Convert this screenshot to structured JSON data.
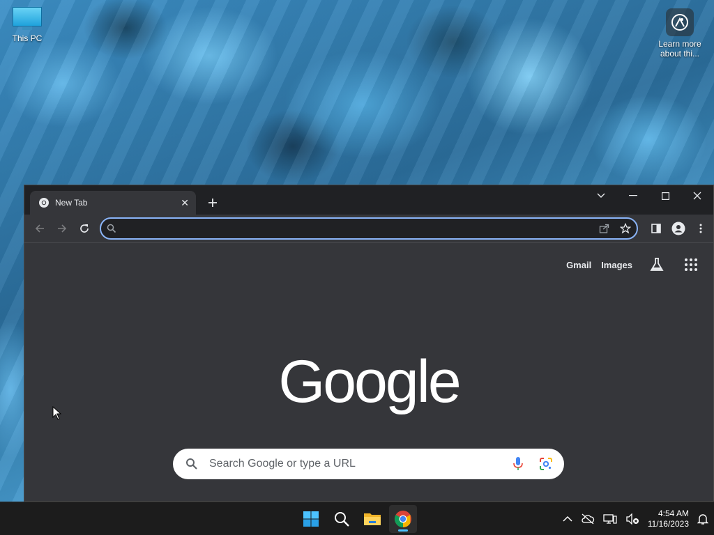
{
  "desktop": {
    "icons": [
      {
        "label": "This PC",
        "icon": "computer-icon"
      },
      {
        "label": "Learn more about thi...",
        "icon": "camera-lens-icon"
      }
    ]
  },
  "browser": {
    "tab": {
      "title": "New Tab",
      "icon": "chrome-icon",
      "close_icon": "close-icon"
    },
    "new_tab_icon": "plus-icon",
    "window_controls": [
      "chevron-down-icon",
      "minimize-icon",
      "maximize-icon",
      "close-icon"
    ],
    "toolbar": {
      "back_icon": "arrow-left-icon",
      "forward_icon": "arrow-right-icon",
      "reload_icon": "reload-icon",
      "omnibox_value": "",
      "omnibox_icon": "search-icon",
      "share_icon": "share-icon",
      "bookmark_icon": "star-icon",
      "sidepanel_icon": "side-panel-icon",
      "profile_icon": "person-icon",
      "menu_icon": "kebab-menu-icon"
    },
    "ntp": {
      "links": {
        "gmail": "Gmail",
        "images": "Images"
      },
      "labs_icon": "flask-icon",
      "apps_icon": "apps-grid-icon",
      "logo": "Google",
      "search_placeholder": "Search Google or type a URL",
      "mic_icon": "microphone-icon",
      "lens_icon": "google-lens-icon"
    }
  },
  "taskbar": {
    "apps": [
      {
        "name": "Start",
        "icon": "windows-icon"
      },
      {
        "name": "Search",
        "icon": "search-icon"
      },
      {
        "name": "File Explorer",
        "icon": "folder-icon"
      },
      {
        "name": "Google Chrome",
        "icon": "chrome-icon",
        "active": true
      }
    ],
    "tray": {
      "overflow_icon": "chevron-up-icon",
      "cloud_icon": "cloud-offline-icon",
      "network_icon": "network-icon",
      "volume_icon": "volume-muted-icon",
      "time": "4:54 AM",
      "date": "11/16/2023",
      "notification_icon": "bell-icon"
    }
  },
  "colors": {
    "omnibox_focus": "#8ab4f8",
    "browser_bg": "#35363a",
    "titlebar_bg": "#202124",
    "taskbar_bg": "#1c1c1c",
    "active_indicator": "#4cc2ff"
  }
}
